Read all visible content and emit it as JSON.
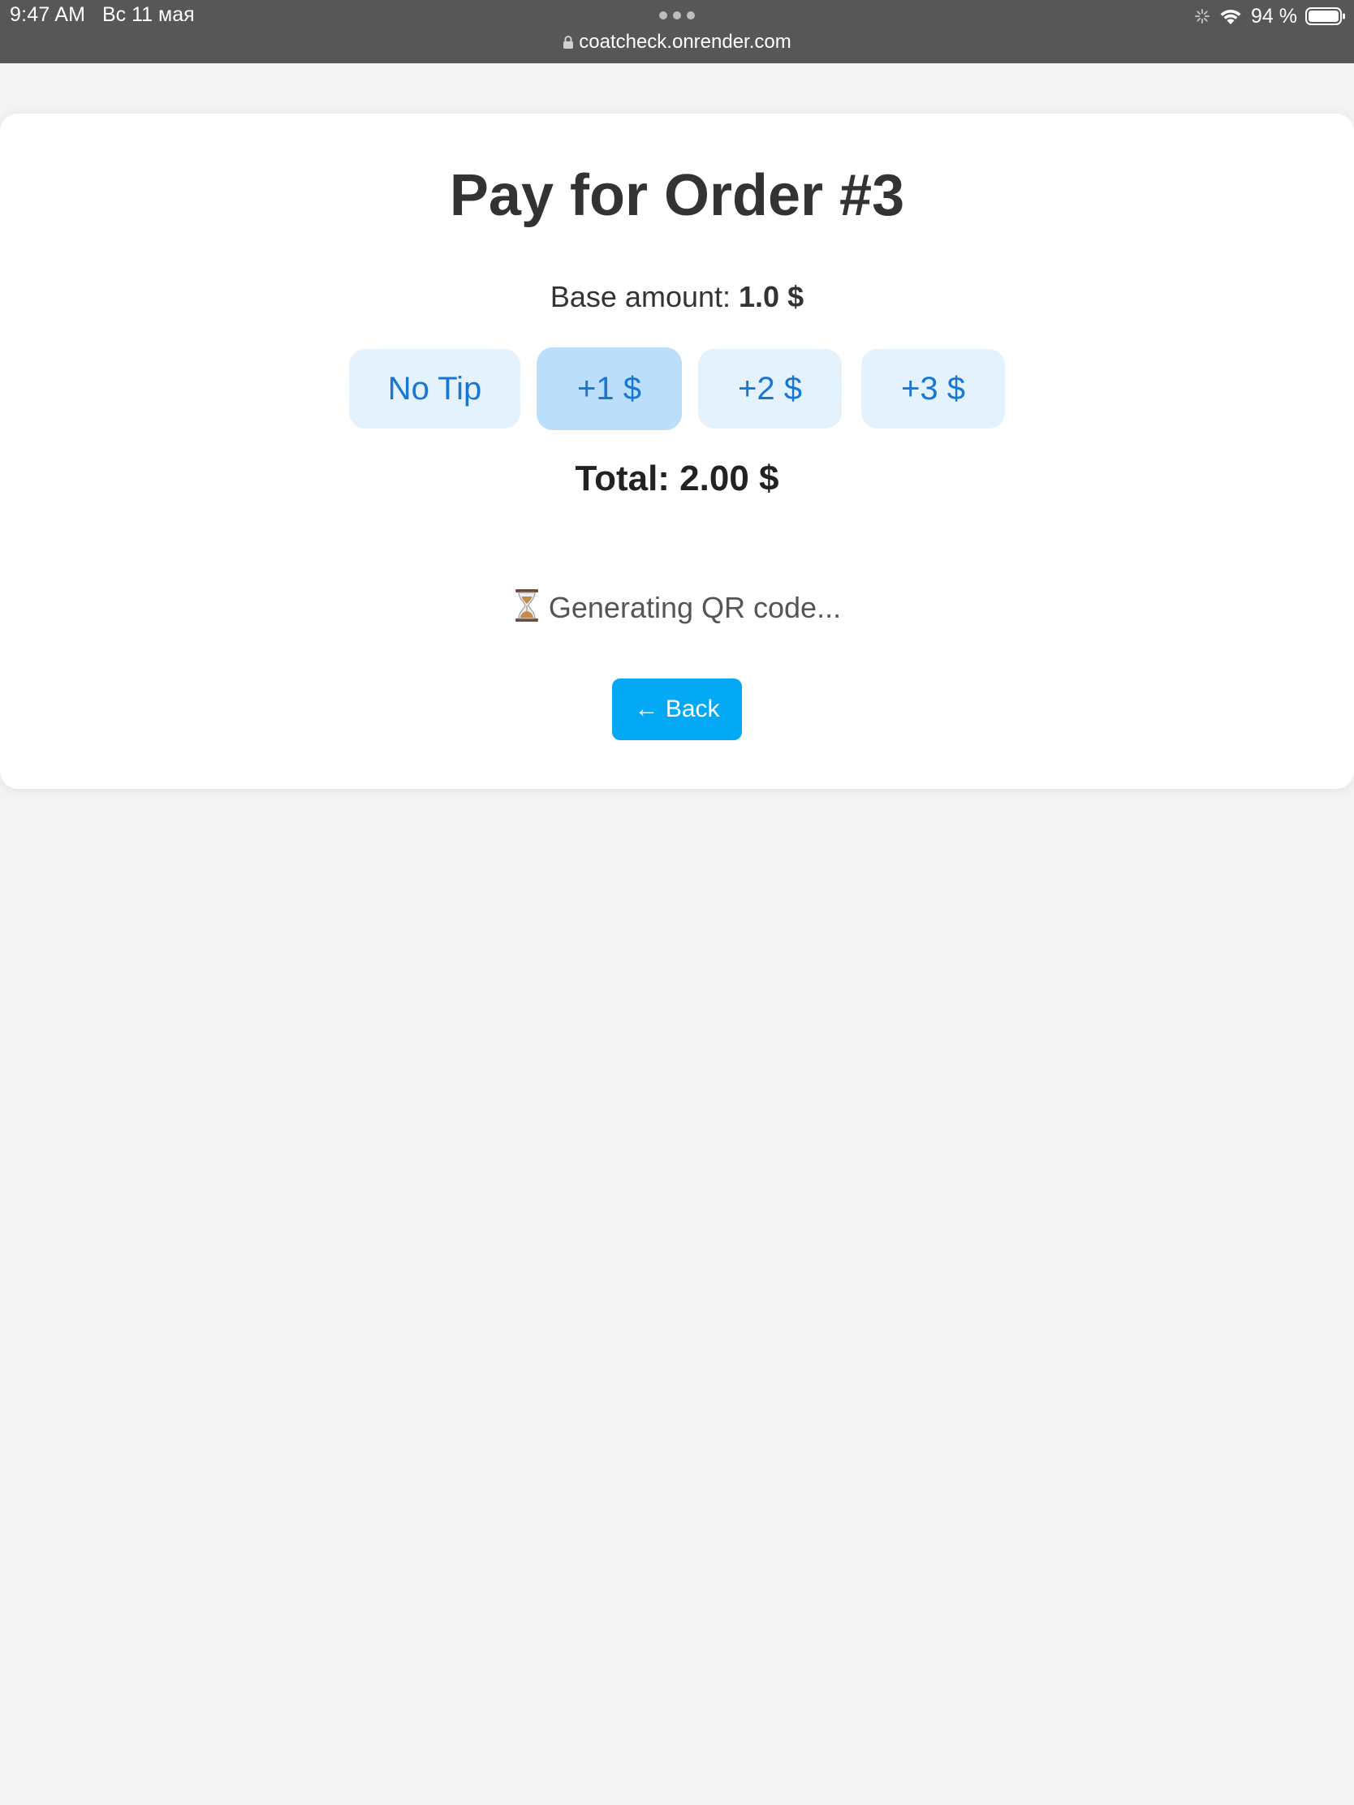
{
  "status_bar": {
    "time": "9:47 AM",
    "date": "Вс 11 мая",
    "battery": "94 %"
  },
  "browser": {
    "url": "coatcheck.onrender.com"
  },
  "page": {
    "title": "Pay for Order #3",
    "base_amount_label": "Base amount:",
    "base_amount_value": "1.0 $",
    "tip_options": [
      {
        "label": "No Tip"
      },
      {
        "label": "+1 $"
      },
      {
        "label": "+2 $"
      },
      {
        "label": "+3 $"
      }
    ],
    "selected_tip": "+1 $",
    "total": "Total: 2.00 $",
    "qr_status": "Generating QR code...",
    "back_label": "← Back"
  },
  "colors": {
    "status_bar_bg": "#575757",
    "tip_bg": "#e3f2fd",
    "tip_selected_bg": "#bbdefb",
    "tip_text": "#1976d2",
    "back_button_bg": "#03a9f4"
  }
}
